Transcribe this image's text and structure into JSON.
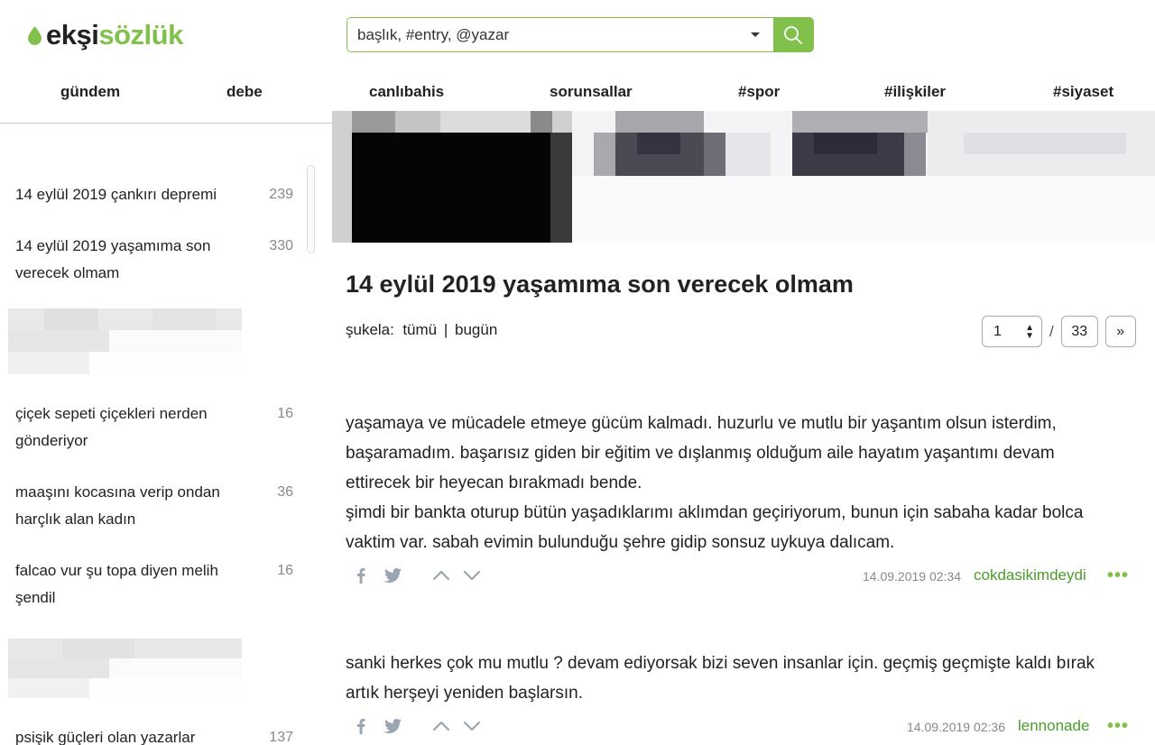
{
  "header": {
    "logo_part1": "ekşi",
    "logo_part2": "sözlük",
    "search_placeholder": "başlık, #entry, @yazar"
  },
  "nav": [
    "gündem",
    "debe",
    "canlıbahis",
    "sorunsallar",
    "#spor",
    "#ilişkiler",
    "#siyaset"
  ],
  "sidebar": {
    "items": [
      {
        "label": "14 eylül 2019 çankırı depremi",
        "count": "239"
      },
      {
        "label": "14 eylül 2019 yaşamıma son verecek olmam",
        "count": "330"
      },
      {
        "label": "çiçek sepeti çiçekleri nerden gönderiyor",
        "count": "16"
      },
      {
        "label": "maaşını kocasına verip ondan harçlık alan kadın",
        "count": "36"
      },
      {
        "label": "falcao vur şu topa diyen melih şendil",
        "count": "16"
      },
      {
        "label": "psişik güçleri olan yazarlar",
        "count": "137"
      }
    ]
  },
  "topic": {
    "title": "14 eylül 2019 yaşamıma son verecek olmam",
    "sukela_label": "şukela:",
    "filter_all": "tümü",
    "filter_separator": "|",
    "filter_today": "bugün"
  },
  "pager": {
    "current": "1",
    "separator": "/",
    "total": "33",
    "next": "»"
  },
  "entries": [
    {
      "text": "yaşamaya ve mücadele etmeye gücüm kalmadı. huzurlu ve mutlu bir yaşantım olsun isterdim, başaramadım. başarısız giden bir eğitim ve dışlanmış olduğum aile hayatım yaşantımı devam ettirecek bir heyecan bırakmadı bende.\nşimdi bir bankta oturup bütün yaşadıklarımı aklımdan geçiriyorum, bunun için sabaha kadar bolca vaktim var. sabah evimin bulunduğu şehre gidip sonsuz uykuya dalıcam.",
      "date": "14.09.2019 02:34",
      "author": "cokdasikimdeydi",
      "more": "•••"
    },
    {
      "text": "sanki herkes çok mu mutlu ? devam ediyorsak bizi seven insanlar için. geçmiş geçmişte kaldı bırak artık herşeyi yeniden başlarsın.",
      "date": "14.09.2019 02:36",
      "author": "lennonade",
      "more": "•••"
    }
  ],
  "colors": {
    "brand_green": "#81c14b",
    "author_green": "#4a9d2a",
    "icon_gray": "#9aa5b1"
  },
  "icons": [
    "drop-icon",
    "chevron-down-icon",
    "search-icon",
    "facebook-icon",
    "twitter-icon",
    "upvote-icon",
    "downvote-icon",
    "more-icon"
  ]
}
